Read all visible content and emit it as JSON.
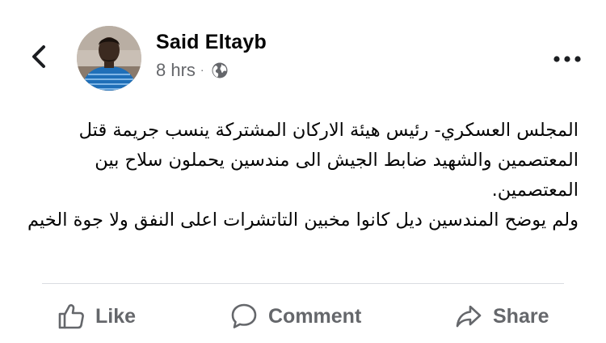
{
  "post": {
    "author_name": "Said Eltayb",
    "timestamp": "8 hrs",
    "separator": "·",
    "privacy": "globe-icon",
    "text": "المجلس العسكري- رئيس هيئة الاركان المشتركة ينسب جريمة قتل المعتصمين والشهيد ضابط الجيش الى مندسين يحملون سلاح بين المعتصمين.\nولم يوضح المندسين ديل كانوا مخبين التاتشرات اعلى النفق ولا جوة الخيم"
  },
  "actions": {
    "like_label": "Like",
    "comment_label": "Comment",
    "share_label": "Share"
  },
  "icons": {
    "back": "chevron-left-icon",
    "more": "more-horizontal-icon",
    "like": "thumbs-up-icon",
    "comment": "speech-bubble-icon",
    "share": "share-arrow-icon"
  },
  "colors": {
    "text": "#050505",
    "secondary": "#65676b",
    "divider": "#dadde1"
  }
}
